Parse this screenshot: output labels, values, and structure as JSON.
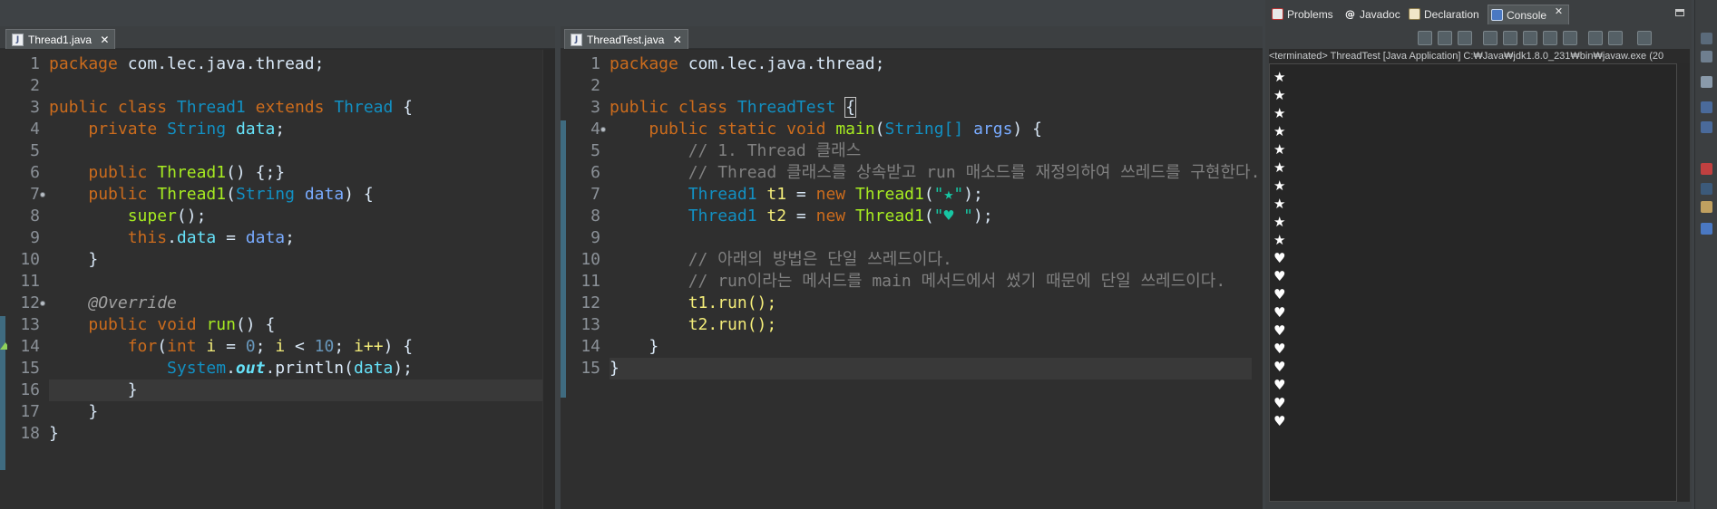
{
  "left_editor": {
    "tab_label": "Thread1.java",
    "close_glyph": "✕",
    "lines": [
      "1",
      "2",
      "3",
      "4",
      "5",
      "6",
      "7",
      "8",
      "9",
      "10",
      "11",
      "12",
      "13",
      "14",
      "15",
      "16",
      "17",
      "18"
    ]
  },
  "mid_editor": {
    "tab_label": "ThreadTest.java",
    "close_glyph": "✕",
    "lines": [
      "1",
      "2",
      "3",
      "4",
      "5",
      "6",
      "7",
      "8",
      "9",
      "10",
      "11",
      "12",
      "13",
      "14",
      "15"
    ]
  },
  "code_text": {
    "package": "package",
    "pkg_name": " com.lec.java.thread;",
    "public": "public",
    "class": "class",
    "thread1": "Thread1",
    "extends": "extends",
    "thread": "Thread",
    "brace_open": " {",
    "private": "private",
    "string": "String",
    "data": "data",
    "semi": ";",
    "ctor_empty": "() {;}",
    "paren_open": "(",
    "paren_close_brace": ") {",
    "super_call": "super",
    "call_end": "();",
    "this_kw": "this",
    "dot": ".",
    "assign": " = ",
    "brace_close": "}",
    "override": "@Override",
    "void_kw": "void",
    "run": "run",
    "paren_pair_brace": "() {",
    "for_kw": "for",
    "int_kw": "int",
    "loop_i": "i",
    "loop_zero": "0",
    "loop_ten": "10",
    "loop_lt": " < ",
    "loop_sep": "; ",
    "loop_inc": "i++",
    "system": "System",
    "out": "out",
    "println": "println",
    "close_call": ");",
    "threadtest": "ThreadTest",
    "static_kw": "static",
    "main": "main",
    "args_type": "String[]",
    "args": "args",
    "cmt1": "// 1. Thread 클래스",
    "cmt2": "// Thread 클래스를 상속받고 run 매소드를 재정의하여 쓰레드를 구현한다.",
    "t1": "t1",
    "t2": "t2",
    "new_kw": "new",
    "star_str": "\"★\"",
    "heart_str": "\"♥ \"",
    "cmt3": "// 아래의 방법은 단일 쓰레드이다.",
    "cmt4": "// run이라는 메서드를 main 메서드에서 썼기 때문에 단일 쓰레드이다.",
    "t1_run": "t1.run();",
    "t2_run": "t2.run();"
  },
  "console": {
    "tabs": [
      "Problems",
      "Javadoc",
      "Declaration",
      "Console"
    ],
    "close_glyph": "✕",
    "status": "<terminated> ThreadTest [Java Application] C:₩Java₩jdk1.8.0_231₩bin₩javaw.exe (20",
    "output": [
      "★",
      "★",
      "★",
      "★",
      "★",
      "★",
      "★",
      "★",
      "★",
      "★",
      "♥",
      "♥",
      "♥",
      "♥",
      "♥",
      "♥",
      "♥",
      "♥",
      "♥",
      "♥"
    ]
  },
  "colors": {
    "editor_bg": "#2f2f2f",
    "keyword": "#cc6c1d",
    "class_name": "#1290c3",
    "method": "#a7ec21",
    "string": "#17c6a3",
    "comment": "#808080"
  }
}
